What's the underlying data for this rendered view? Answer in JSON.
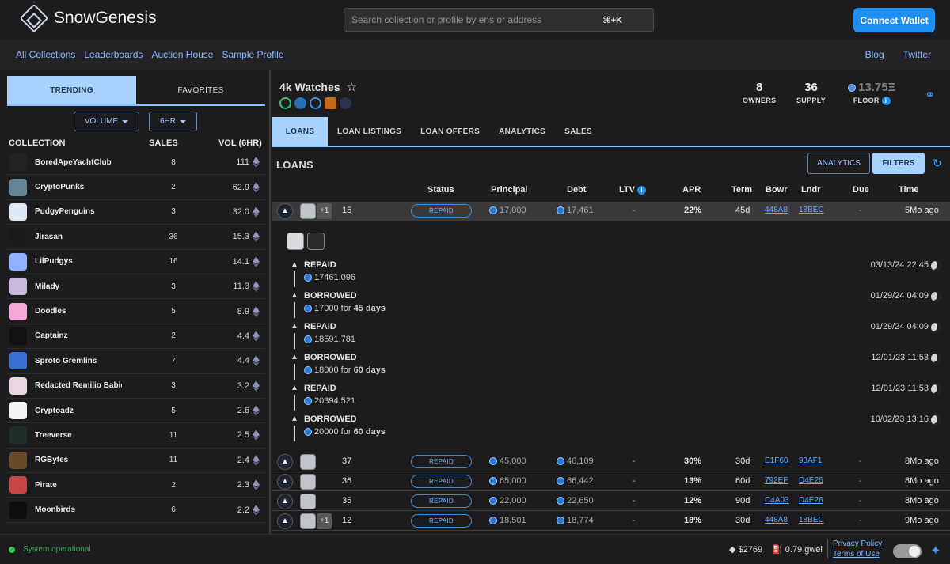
{
  "header": {
    "logo_text": "SnowGenesis",
    "search_placeholder": "Search collection or profile by ens or address",
    "search_shortcut": "⌘+K",
    "connect_label": "Connect Wallet"
  },
  "nav": {
    "left": [
      "All Collections",
      "Leaderboards",
      "Auction House",
      "Sample Profile"
    ],
    "right": [
      "Blog",
      "Twitter"
    ]
  },
  "sidebar": {
    "tabs": [
      "TRENDING",
      "FAVORITES"
    ],
    "active_tab": "TRENDING",
    "sort_dropdown": "VOLUME",
    "period_dropdown": "6HR",
    "col_collection": "COLLECTION",
    "col_sales": "SALES",
    "col_vol": "VOL (6HR)",
    "collections": [
      {
        "name": "BoredApeYachtClub",
        "sales": "8",
        "vol": "111",
        "color": "#222"
      },
      {
        "name": "CryptoPunks",
        "sales": "2",
        "vol": "62.9",
        "color": "#638596"
      },
      {
        "name": "PudgyPenguins",
        "sales": "3",
        "vol": "32.0",
        "color": "#dfe9f5"
      },
      {
        "name": "Jirasan",
        "sales": "36",
        "vol": "15.3",
        "color": "#1a1a1a"
      },
      {
        "name": "LilPudgys",
        "sales": "16",
        "vol": "14.1",
        "color": "#8fb1ff"
      },
      {
        "name": "Milady",
        "sales": "3",
        "vol": "11.3",
        "color": "#c9b9d9"
      },
      {
        "name": "Doodles",
        "sales": "5",
        "vol": "8.9",
        "color": "#f2a7d8"
      },
      {
        "name": "Captainz",
        "sales": "2",
        "vol": "4.4",
        "color": "#111"
      },
      {
        "name": "Sproto Gremlins",
        "sales": "7",
        "vol": "4.4",
        "color": "#3a6fd1"
      },
      {
        "name": "Redacted Remilio Babies",
        "sales": "3",
        "vol": "3.2",
        "color": "#e8d6e0"
      },
      {
        "name": "Cryptoadz",
        "sales": "5",
        "vol": "2.6",
        "color": "#f5f5f5"
      },
      {
        "name": "Treeverse",
        "sales": "11",
        "vol": "2.5",
        "color": "#1f2e26"
      },
      {
        "name": "RGBytes",
        "sales": "11",
        "vol": "2.4",
        "color": "#6b4a2a"
      },
      {
        "name": "Pirate",
        "sales": "2",
        "vol": "2.3",
        "color": "#c94444"
      },
      {
        "name": "Moonbirds",
        "sales": "6",
        "vol": "2.2",
        "color": "#0f0f0f"
      }
    ]
  },
  "collection": {
    "title": "4k Watches",
    "owners": "8",
    "owners_label": "OWNERS",
    "supply": "36",
    "supply_label": "SUPPLY",
    "floor": "13.75Ξ",
    "floor_label": "FLOOR"
  },
  "main_tabs": [
    "LOANS",
    "LOAN LISTINGS",
    "LOAN OFFERS",
    "ANALYTICS",
    "SALES"
  ],
  "loans": {
    "title": "LOANS",
    "analytics_btn": "ANALYTICS",
    "filters_btn": "FILTERS",
    "columns": [
      "Status",
      "Principal",
      "Debt",
      "LTV",
      "APR",
      "Term",
      "Bowr",
      "Lndr",
      "Due",
      "Time"
    ],
    "rows": [
      {
        "extra": "+1",
        "id": "15",
        "status": "REPAID",
        "principal": "17,000",
        "debt": "17,461",
        "ltv": "-",
        "apr": "22%",
        "term": "45d",
        "bowr": "448A8",
        "lndr": "18BEC",
        "due": "-",
        "time": "5Mo ago"
      },
      {
        "extra": "",
        "id": "37",
        "status": "REPAID",
        "principal": "45,000",
        "debt": "46,109",
        "ltv": "-",
        "apr": "30%",
        "term": "30d",
        "bowr": "E1F60",
        "lndr": "93AF1",
        "due": "-",
        "time": "8Mo ago"
      },
      {
        "extra": "",
        "id": "36",
        "status": "REPAID",
        "principal": "65,000",
        "debt": "66,442",
        "ltv": "-",
        "apr": "13%",
        "term": "60d",
        "bowr": "792EF",
        "lndr": "D4E26",
        "due": "-",
        "time": "8Mo ago"
      },
      {
        "extra": "",
        "id": "35",
        "status": "REPAID",
        "principal": "22,000",
        "debt": "22,650",
        "ltv": "-",
        "apr": "12%",
        "term": "90d",
        "bowr": "C4A03",
        "lndr": "D4E26",
        "due": "-",
        "time": "8Mo ago"
      },
      {
        "extra": "+1",
        "id": "12",
        "status": "REPAID",
        "principal": "18,501",
        "debt": "18,774",
        "ltv": "-",
        "apr": "18%",
        "term": "30d",
        "bowr": "448A8",
        "lndr": "18BEC",
        "due": "-",
        "time": "9Mo ago"
      }
    ],
    "timeline": [
      {
        "event": "REPAID",
        "amount": "17461.096",
        "for_text": "",
        "days": "",
        "date": "03/13/24 22:45"
      },
      {
        "event": "BORROWED",
        "amount": "17000",
        "for_text": "for",
        "days": "45 days",
        "date": "01/29/24 04:09"
      },
      {
        "event": "REPAID",
        "amount": "18591.781",
        "for_text": "",
        "days": "",
        "date": "01/29/24 04:09"
      },
      {
        "event": "BORROWED",
        "amount": "18000",
        "for_text": "for",
        "days": "60 days",
        "date": "12/01/23 11:53"
      },
      {
        "event": "REPAID",
        "amount": "20394.521",
        "for_text": "",
        "days": "",
        "date": "12/01/23 11:53"
      },
      {
        "event": "BORROWED",
        "amount": "20000",
        "for_text": "for",
        "days": "60 days",
        "date": "10/02/23 13:16"
      }
    ]
  },
  "footer": {
    "status": "System operational",
    "eth_price": "$2769",
    "gas": "0.79 gwei",
    "privacy": "Privacy Policy",
    "terms": "Terms of Use"
  }
}
